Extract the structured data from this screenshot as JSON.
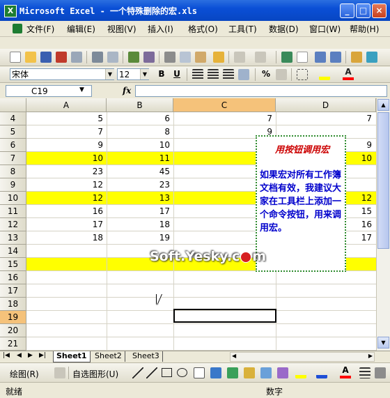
{
  "window": {
    "title": "Microsoft Excel - 一个特殊删除的宏.xls",
    "minimize": "_",
    "maximize": "□",
    "close": "×"
  },
  "menu": [
    {
      "label": "文件(F)"
    },
    {
      "label": "编辑(E)"
    },
    {
      "label": "视图(V)"
    },
    {
      "label": "插入(I)"
    },
    {
      "label": "格式(O)"
    },
    {
      "label": "工具(T)"
    },
    {
      "label": "数据(D)"
    },
    {
      "label": "窗口(W)"
    },
    {
      "label": "帮助(H)"
    }
  ],
  "format": {
    "font": "宋体",
    "size": "12",
    "bold": "B",
    "underline": "U",
    "percent": "%"
  },
  "formula": {
    "name_box": "C19",
    "fx": "fx"
  },
  "columns": [
    "A",
    "B",
    "C",
    "D"
  ],
  "selected_column": "C",
  "selected_row": "19",
  "rows": [
    {
      "num": "4",
      "a": "5",
      "b": "6",
      "c": "7",
      "d": "7",
      "hl": false
    },
    {
      "num": "5",
      "a": "7",
      "b": "8",
      "c": "9",
      "d": "",
      "hl": false
    },
    {
      "num": "6",
      "a": "9",
      "b": "10",
      "c": "",
      "d": "9",
      "hl": false
    },
    {
      "num": "7",
      "a": "10",
      "b": "11",
      "c": "",
      "d": "10",
      "hl": true
    },
    {
      "num": "8",
      "a": "23",
      "b": "45",
      "c": "",
      "d": "",
      "hl": false
    },
    {
      "num": "9",
      "a": "12",
      "b": "23",
      "c": "",
      "d": "",
      "hl": false
    },
    {
      "num": "10",
      "a": "12",
      "b": "13",
      "c": "",
      "d": "12",
      "hl": true
    },
    {
      "num": "11",
      "a": "16",
      "b": "17",
      "c": "",
      "d": "15",
      "hl": false
    },
    {
      "num": "12",
      "a": "17",
      "b": "18",
      "c": "",
      "d": "16",
      "hl": false
    },
    {
      "num": "13",
      "a": "18",
      "b": "19",
      "c": "",
      "d": "17",
      "hl": false
    },
    {
      "num": "14",
      "a": "",
      "b": "",
      "c": "",
      "d": "",
      "hl": false
    },
    {
      "num": "15",
      "a": "",
      "b": "",
      "c": "",
      "d": "",
      "hl": true
    },
    {
      "num": "16",
      "a": "",
      "b": "",
      "c": "",
      "d": "",
      "hl": false
    },
    {
      "num": "17",
      "a": "",
      "b": "",
      "c": "",
      "d": "",
      "hl": false
    },
    {
      "num": "18",
      "a": "",
      "b": "",
      "c": "",
      "d": "",
      "hl": false
    },
    {
      "num": "19",
      "a": "",
      "b": "",
      "c": "",
      "d": "",
      "hl": false
    },
    {
      "num": "20",
      "a": "",
      "b": "",
      "c": "",
      "d": "",
      "hl": false
    },
    {
      "num": "21",
      "a": "",
      "b": "",
      "c": "",
      "d": "",
      "hl": false
    }
  ],
  "callout": {
    "title": "用按钮调用宏",
    "body": "如果宏对所有工作簿文档有效，我建议大家在工具栏上添加一个命令按钮，用来调用宏。"
  },
  "watermark": "Soft.Yesky.c",
  "watermark_tail": "m",
  "sheets": [
    {
      "label": "Sheet1"
    },
    {
      "label": "Sheet2"
    },
    {
      "label": "Sheet3"
    }
  ],
  "drawing": {
    "draw_menu": "绘图(R)",
    "autoshapes": "自选图形(U)"
  },
  "status": {
    "ready": "就绪",
    "num": "数字"
  },
  "colors": {
    "title_bar": "#0a4fd6",
    "highlight": "#ffff00",
    "callout_text": "#0000cc",
    "callout_title": "#cc0000",
    "callout_border": "#2e8b2e",
    "selected_header": "#f5c27a"
  }
}
